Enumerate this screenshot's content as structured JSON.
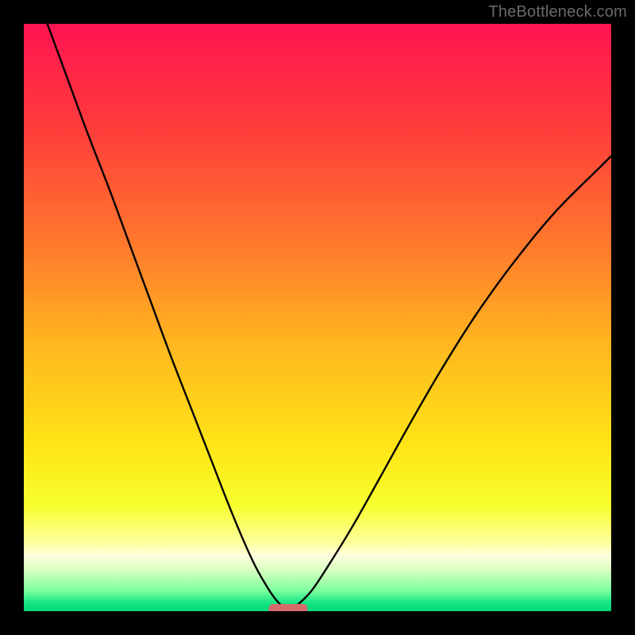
{
  "watermark": "TheBottleneck.com",
  "colors": {
    "frame": "#000000",
    "curve": "#000000",
    "marker": "#d66b6b",
    "gradient_stops": [
      {
        "offset": 0.0,
        "color": "#ff1452"
      },
      {
        "offset": 0.18,
        "color": "#ff3d3b"
      },
      {
        "offset": 0.38,
        "color": "#ff7a2c"
      },
      {
        "offset": 0.55,
        "color": "#ffb81f"
      },
      {
        "offset": 0.72,
        "color": "#ffe516"
      },
      {
        "offset": 0.82,
        "color": "#f7ff2e"
      },
      {
        "offset": 0.885,
        "color": "#ffffa0"
      },
      {
        "offset": 0.905,
        "color": "#ffffe0"
      },
      {
        "offset": 0.93,
        "color": "#d8ffc0"
      },
      {
        "offset": 0.965,
        "color": "#7dff9e"
      },
      {
        "offset": 0.985,
        "color": "#18e685"
      },
      {
        "offset": 1.0,
        "color": "#00d879"
      }
    ]
  },
  "chart_data": {
    "type": "line",
    "title": "",
    "xlabel": "",
    "ylabel": "",
    "xlim": [
      0,
      1
    ],
    "ylim": [
      0,
      1
    ],
    "grid": false,
    "legend": false,
    "note": "y-values are bottleneck fraction (0 at bottom / optimal, 1 at top / worst). x is normalized horizontal position. Values estimated from pixel positions.",
    "series": [
      {
        "name": "left-branch",
        "x": [
          0.04,
          0.075,
          0.11,
          0.145,
          0.18,
          0.215,
          0.25,
          0.285,
          0.32,
          0.35,
          0.375,
          0.395,
          0.412,
          0.425,
          0.435,
          0.443,
          0.45
        ],
        "y": [
          1.0,
          0.905,
          0.81,
          0.72,
          0.625,
          0.53,
          0.435,
          0.345,
          0.255,
          0.178,
          0.118,
          0.075,
          0.045,
          0.025,
          0.013,
          0.006,
          0.0
        ]
      },
      {
        "name": "right-branch",
        "x": [
          0.45,
          0.465,
          0.49,
          0.52,
          0.56,
          0.605,
          0.655,
          0.71,
          0.77,
          0.835,
          0.905,
          0.98,
          1.0
        ],
        "y": [
          0.0,
          0.01,
          0.035,
          0.08,
          0.145,
          0.225,
          0.315,
          0.41,
          0.505,
          0.595,
          0.68,
          0.755,
          0.775
        ]
      }
    ],
    "marker": {
      "shape": "rounded-bar",
      "x_center": 0.45,
      "x_halfwidth": 0.033,
      "y": 0.0,
      "color": "#d66b6b"
    }
  }
}
